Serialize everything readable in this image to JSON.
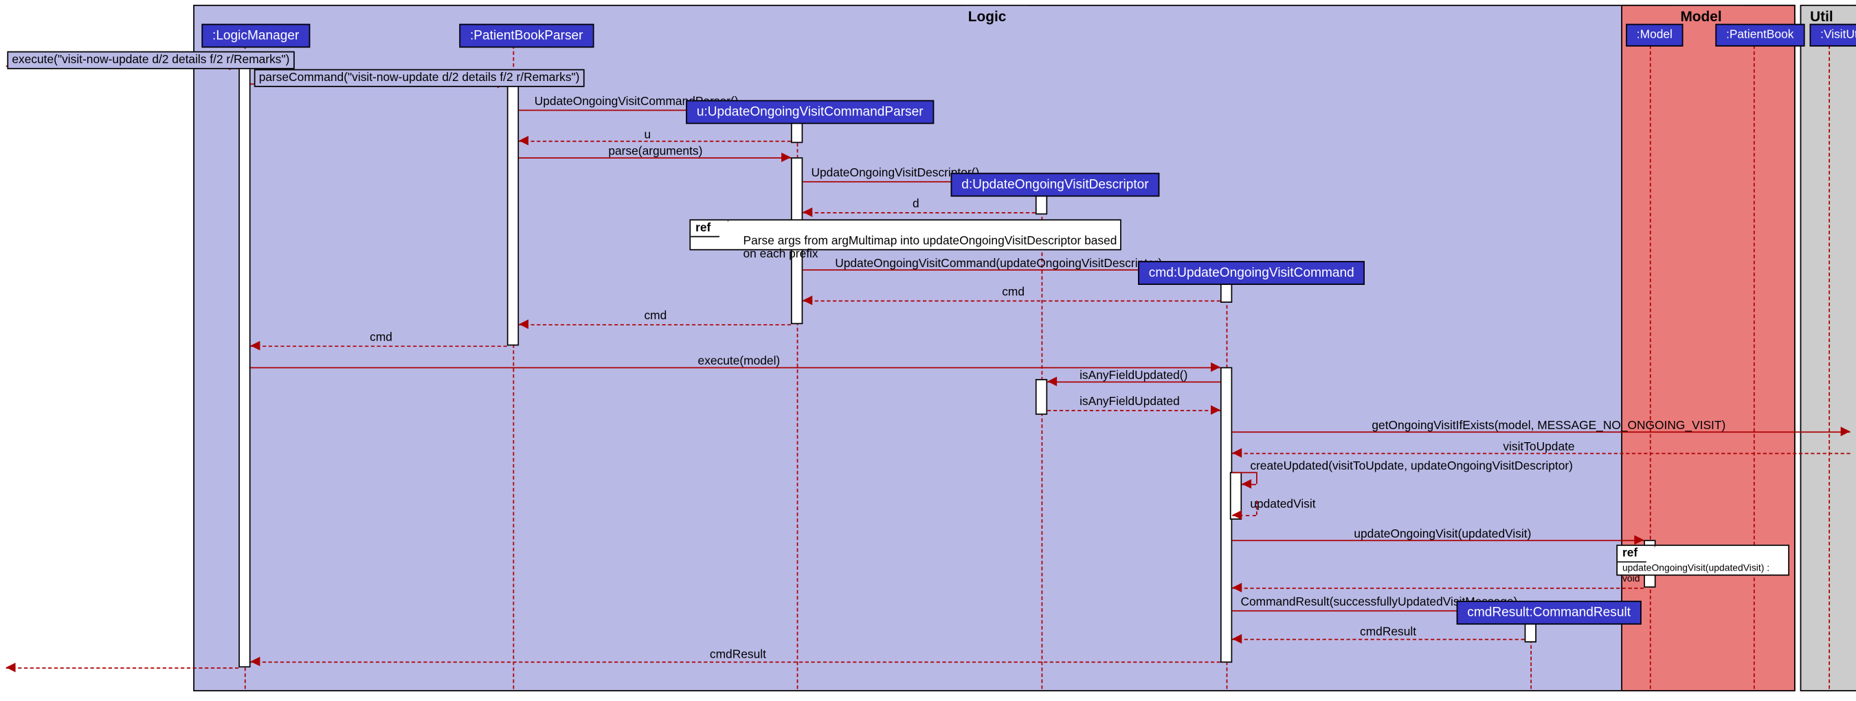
{
  "frames": {
    "logic": "Logic",
    "model": "Model",
    "util": "Util"
  },
  "participants": {
    "logicManager": ":LogicManager",
    "patientBookParser": ":PatientBookParser",
    "uParser": "u:UpdateOngoingVisitCommandParser",
    "dDescriptor": "d:UpdateOngoingVisitDescriptor",
    "cmd": "cmd:UpdateOngoingVisitCommand",
    "model": ":Model",
    "patientBook": ":PatientBook",
    "visitUtil": ":VisitUtil",
    "cmdResult": "cmdResult:CommandResult"
  },
  "messages": {
    "m1": "execute(\"visit-now-update d/2 details f/2 r/Remarks\")",
    "m2": "parseCommand(\"visit-now-update d/2 details f/2 r/Remarks\")",
    "m3": "UpdateOngoingVisitCommandParser()",
    "m4": "u",
    "m5": "parse(arguments)",
    "m6": "UpdateOngoingVisitDescriptor()",
    "m7": "d",
    "m8": "UpdateOngoingVisitCommand(updateOngoingVisitDescriptor)",
    "m9": "cmd",
    "m10": "cmd",
    "m11": "cmd",
    "m12": "execute(model)",
    "m13": "isAnyFieldUpdated()",
    "m14": "isAnyFieldUpdated",
    "m15": "getOngoingVisitIfExists(model, MESSAGE_NO_ONGOING_VISIT)",
    "m16": "visitToUpdate",
    "m17": "createUpdated(visitToUpdate, updateOngoingVisitDescriptor)",
    "m18": "updatedVisit",
    "m19": "updateOngoingVisit(updatedVisit)",
    "m20": "CommandResult(successfullyUpdatedVisitMessage)",
    "m21": "cmdResult",
    "m22": "cmdResult"
  },
  "refs": {
    "r1": {
      "label": "ref",
      "text": "Parse args from argMultimap into updateOngoingVisitDescriptor based on each prefix"
    },
    "r2": {
      "label": "ref",
      "text": "updateOngoingVisit(updatedVisit) : void"
    }
  }
}
